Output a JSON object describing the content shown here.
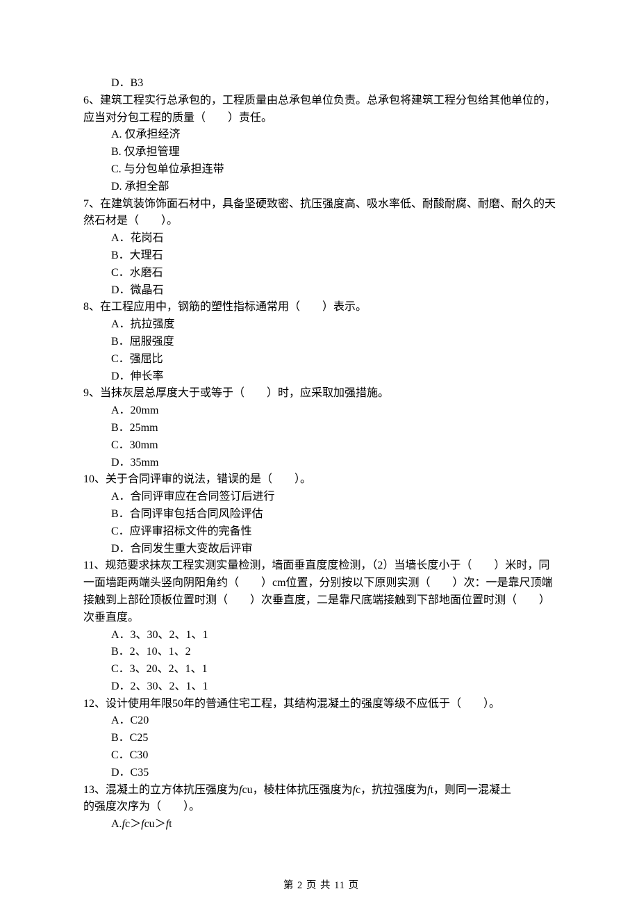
{
  "q5_d": "D．B3",
  "q6": "6、建筑工程实行总承包的，工程质量由总承包单位负责。总承包将建筑工程分包给其他单位的，应当对分包工程的质量（　　）责任。",
  "q6_a": "A. 仅承担经济",
  "q6_b": "B. 仅承担管理",
  "q6_c": "C. 与分包单位承担连带",
  "q6_d": "D. 承担全部",
  "q7": "7、在建筑装饰饰面石材中，具备坚硬致密、抗压强度高、吸水率低、耐酸耐腐、耐磨、耐久的天然石材是（　　）。",
  "q7_a": "A．花岗石",
  "q7_b": "B．大理石",
  "q7_c": "C．水磨石",
  "q7_d": "D．微晶石",
  "q8": "8、在工程应用中，钢筋的塑性指标通常用（　　）表示。",
  "q8_a": "A．抗拉强度",
  "q8_b": "B．屈服强度",
  "q8_c": "C．强屈比",
  "q8_d": "D．伸长率",
  "q9": "9、当抹灰层总厚度大于或等于（　　）时，应采取加强措施。",
  "q9_a": "A．20mm",
  "q9_b": "B．25mm",
  "q9_c": "C．30mm",
  "q9_d": "D．35mm",
  "q10": "10、关于合同评审的说法，错误的是（　　）。",
  "q10_a": "A．合同评审应在合同签订后进行",
  "q10_b": "B．合同评审包括合同风险评估",
  "q10_c": "C．应评审招标文件的完备性",
  "q10_d": "D．合同发生重大变故后评审",
  "q11": "11、规范要求抹灰工程实测实量检测，墙面垂直度度检测，（2）当墙长度小于（　　）米时，同一面墙距两端头竖向阴阳角约（　　）cm位置，分别按以下原则实测（　　）次：一是靠尺顶端接触到上部砼顶板位置时测（　　）次垂直度，二是靠尺底端接触到下部地面位置时测（　　） 次垂直度。",
  "q11_a": "A．3、30、2、1、1",
  "q11_b": "B．2、10、1、2",
  "q11_c": "C．3、20、2、1、1",
  "q11_d": "D．2、30、2、1、1",
  "q12": "12、设计使用年限50年的普通住宅工程，其结构混凝土的强度等级不应低于（　　）。",
  "q12_a": "A．C20",
  "q12_b": "B．C25",
  "q12_c": "C．C30",
  "q12_d": "D．C35",
  "q13_pre": "13、混凝土的立方体抗压强度为",
  "q13_fcu": "f",
  "q13_cu": "cu，棱柱体抗压强度为",
  "q13_fc": "f",
  "q13_c": "c，抗拉强度为",
  "q13_ft": "f",
  "q13_t": "t，则同一混凝土",
  "q13_line2": "的强度次序为（　　）。",
  "q13_a_lead": "A.",
  "q13_a_f1": "f",
  "q13_a_t1": "c＞",
  "q13_a_f2": "f",
  "q13_a_t2": "cu＞",
  "q13_a_f3": "f",
  "q13_a_t3": "t",
  "footer": "第 2 页 共 11 页"
}
